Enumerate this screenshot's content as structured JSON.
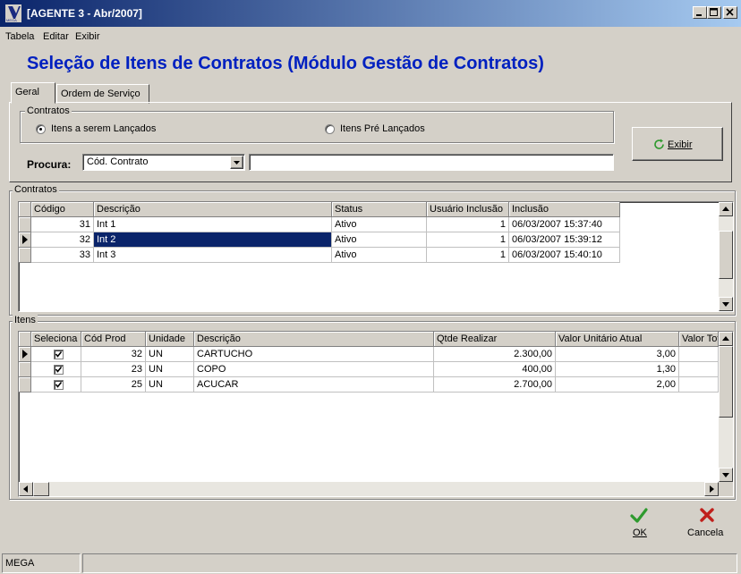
{
  "window": {
    "title": "[AGENTE 3 - Abr/2007]"
  },
  "menu": [
    "Tabela",
    "Editar",
    "Exibir"
  ],
  "heading": "Seleção de Itens de Contratos (Módulo Gestão de Contratos)",
  "tabs": [
    "Geral",
    "Ordem de Serviço"
  ],
  "contratos_group": {
    "legend": "Contratos",
    "radio1": "Itens a serem Lançados",
    "radio2": "Itens Pré Lançados",
    "selected": "radio1"
  },
  "procura": {
    "label": "Procura:",
    "value": "Cód. Contrato",
    "text": ""
  },
  "exibir_button": {
    "label": "Exibir"
  },
  "contratos_grid": {
    "legend": "Contratos",
    "columns": [
      "Código",
      "Descrição",
      "Status",
      "Usuário Inclusão",
      "Inclusão"
    ],
    "rows": [
      {
        "codigo": "31",
        "descricao": "Int 1",
        "status": "Ativo",
        "usuario": "1",
        "inclusao": "06/03/2007 15:37:40"
      },
      {
        "codigo": "32",
        "descricao": "Int 2",
        "status": "Ativo",
        "usuario": "1",
        "inclusao": "06/03/2007 15:39:12"
      },
      {
        "codigo": "33",
        "descricao": "Int 3",
        "status": "Ativo",
        "usuario": "1",
        "inclusao": "06/03/2007 15:40:10"
      }
    ]
  },
  "itens_grid": {
    "legend": "Itens",
    "columns": [
      "Seleciona",
      "Cód Prod",
      "Unidade",
      "Descrição",
      "Qtde Realizar",
      "Valor Unitário Atual",
      "Valor Tot"
    ],
    "rows": [
      {
        "checked": true,
        "cod": "32",
        "unidade": "UN",
        "descricao": "CARTUCHO",
        "qtde": "2.300,00",
        "valor": "3,00"
      },
      {
        "checked": true,
        "cod": "23",
        "unidade": "UN",
        "descricao": "COPO",
        "qtde": "400,00",
        "valor": "1,30"
      },
      {
        "checked": true,
        "cod": "25",
        "unidade": "UN",
        "descricao": "ACUCAR",
        "qtde": "2.700,00",
        "valor": "2,00"
      }
    ]
  },
  "ok_button": {
    "label": "OK"
  },
  "cancel_button": {
    "label": "Cancela"
  },
  "statusbar": {
    "text": "MEGA"
  },
  "colors": {
    "title_gradient_start": "#0a246a",
    "title_gradient_end": "#a6caf0",
    "heading": "#0020c0",
    "selection": "#0a246a",
    "ok": "#2e9a2e",
    "cancel": "#c0201c"
  },
  "icons": [
    "app-logo-icon",
    "minimize-icon",
    "maximize-icon",
    "close-icon",
    "refresh-icon",
    "checkmark-icon",
    "x-icon",
    "row-pointer-icon",
    "dropdown-arrow-icon",
    "scroll-up-icon",
    "scroll-down-icon",
    "scroll-left-icon",
    "scroll-right-icon"
  ]
}
